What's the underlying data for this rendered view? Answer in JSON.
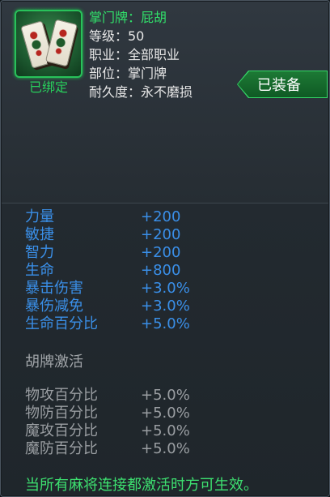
{
  "item": {
    "name": "掌门牌：屁胡",
    "level": "等级：50",
    "class": "职业：全部职业",
    "slot": "部位：掌门牌",
    "durability": "耐久度：永不磨损",
    "bound": "已绑定",
    "equipped": "已装备",
    "icon": "mahjong-tiles-icon"
  },
  "base_stats": [
    {
      "label": "力量",
      "value": "+200"
    },
    {
      "label": "敏捷",
      "value": "+200"
    },
    {
      "label": "智力",
      "value": "+200"
    },
    {
      "label": "生命",
      "value": "+800"
    },
    {
      "label": "暴击伤害",
      "value": "+3.0%"
    },
    {
      "label": "暴伤减免",
      "value": "+3.0%"
    },
    {
      "label": "生命百分比",
      "value": "+5.0%"
    }
  ],
  "hupai_section": {
    "title": "胡牌激活",
    "stats": [
      {
        "label": "物攻百分比",
        "value": "+5.0%"
      },
      {
        "label": "物防百分比",
        "value": "+5.0%"
      },
      {
        "label": "魔攻百分比",
        "value": "+5.0%"
      },
      {
        "label": "魔防百分比",
        "value": "+5.0%"
      }
    ]
  },
  "notice": "当所有麻将连接都激活时方可生效。",
  "colors": {
    "accent_green": "#31e06a",
    "stat_blue": "#3a8fe8",
    "inactive_gray": "#9a9ea2"
  }
}
